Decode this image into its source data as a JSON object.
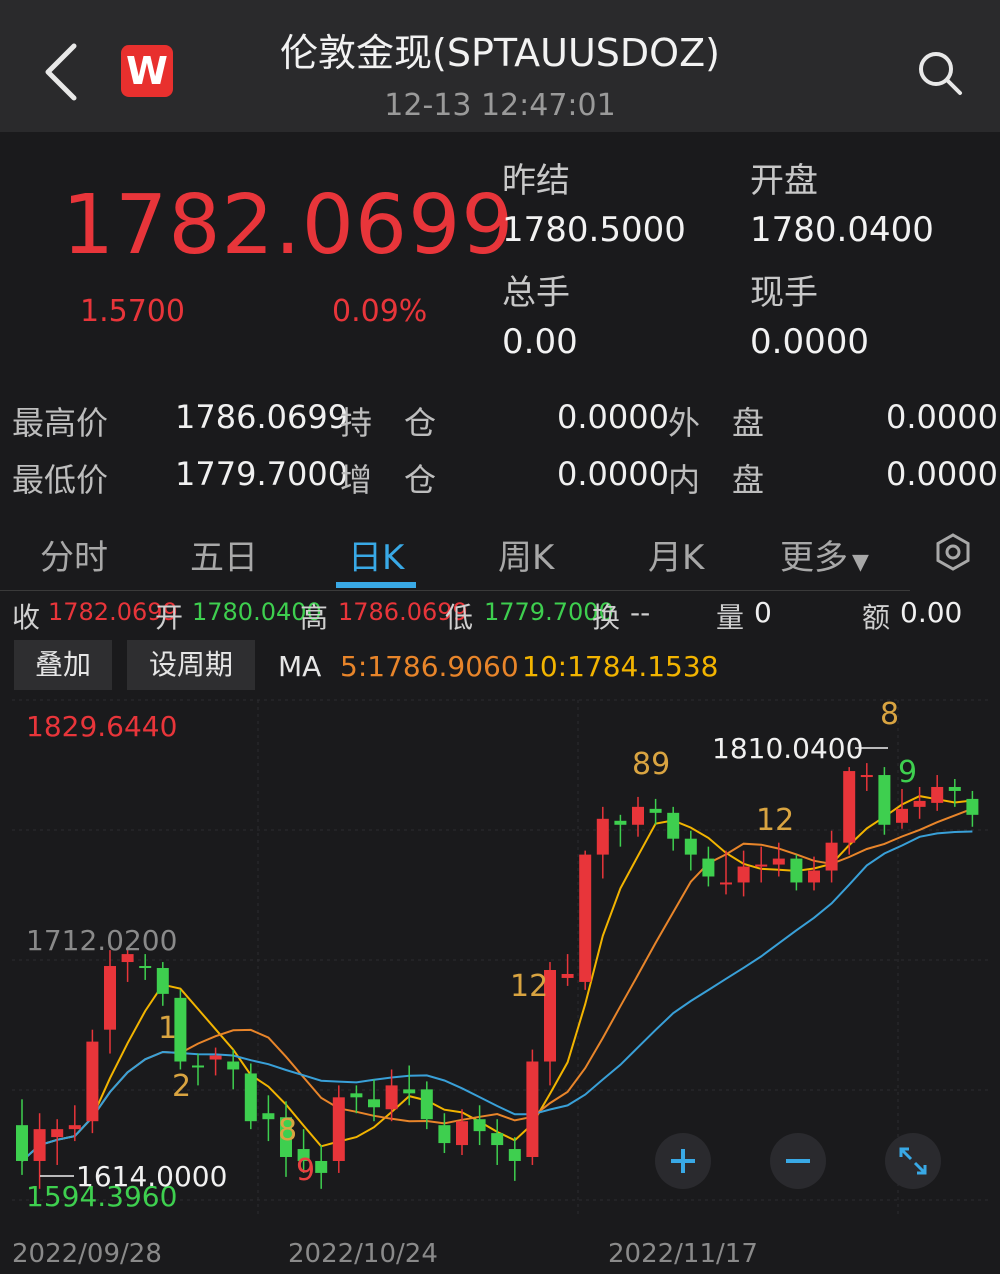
{
  "header": {
    "title": "伦敦金现(SPTAUUSDOZ)",
    "time": "12-13 12:47:01",
    "logo_letter": "W"
  },
  "quote": {
    "price": "1782.0699",
    "change": "1.5700",
    "change_pct": "0.09%",
    "prev_close_label": "昨结",
    "prev_close": "1780.5000",
    "open_label": "开盘",
    "open": "1780.0400",
    "volume_label": "总手",
    "volume": "0.00",
    "current_hand_label": "现手",
    "current_hand": "0.0000"
  },
  "stats": {
    "high_label": "最高价",
    "high": "1786.0699",
    "low_label": "最低价",
    "low": "1779.7000",
    "hold_label": "持　仓",
    "hold": "0.0000",
    "add_label": "增　仓",
    "add": "0.0000",
    "outer_label": "外　盘",
    "outer": "0.0000",
    "inner_label": "内　盘",
    "inner": "0.0000"
  },
  "tabs": [
    "分时",
    "五日",
    "日K",
    "周K",
    "月K",
    "更多"
  ],
  "active_tab": "日K",
  "ohlc_bar": {
    "close_label": "收",
    "close": "1782.0699",
    "open_label": "开",
    "open": "1780.0400",
    "high_label": "高",
    "high": "1786.0699",
    "low_label": "低",
    "low": "1779.7000",
    "turnover_label": "换",
    "turnover": "--",
    "volume_label": "量",
    "volume": "0",
    "amount_label": "额",
    "amount": "0.00"
  },
  "buttons": {
    "overlay": "叠加",
    "period": "设周期"
  },
  "ma": {
    "label": "MA",
    "ma5": "5:1786.9060",
    "ma10": "10:1784.1538"
  },
  "chart_labels": {
    "top": "1829.6440",
    "mid": "1712.0200",
    "bottom": "1594.3960",
    "high_marker": "1810.0400",
    "low_marker": "1614.0000",
    "dates": [
      "2022/09/28",
      "2022/10/24",
      "2022/11/17"
    ],
    "counts": [
      {
        "text": "1",
        "color": "#d9a441"
      },
      {
        "text": "2",
        "color": "#d9a441"
      },
      {
        "text": "8",
        "color": "#d9a441"
      },
      {
        "text": "9",
        "color": "#e84040"
      },
      {
        "text": "12",
        "color": "#d9a441"
      },
      {
        "text": "89",
        "color": "#d9a441"
      },
      {
        "text": "12",
        "color": "#d9a441"
      },
      {
        "text": "8",
        "color": "#d9a441"
      },
      {
        "text": "9",
        "color": "#3ecf4f"
      }
    ]
  },
  "chart_data": {
    "type": "candlestick",
    "y_axis_labels": [
      "1829.6440",
      "1712.0200",
      "1594.3960"
    ],
    "x_tick_labels": [
      "2022/09/28",
      "2022/10/24",
      "2022/11/17"
    ],
    "annotations": [
      "1810.0400",
      "1614.0000"
    ],
    "ma_series": [
      {
        "name": "MA5",
        "color": "#f2b400"
      },
      {
        "name": "MA10",
        "color": "#e8852a"
      },
      {
        "name": "MA20",
        "color": "#39a0d8"
      }
    ],
    "candles": [
      [
        1630,
        1612,
        1643,
        1605
      ],
      [
        1612,
        1628,
        1636,
        1598
      ],
      [
        1624,
        1628,
        1633,
        1610
      ],
      [
        1628,
        1630,
        1640,
        1622
      ],
      [
        1632,
        1672,
        1678,
        1626
      ],
      [
        1678,
        1710,
        1718,
        1666
      ],
      [
        1712,
        1716,
        1719,
        1702
      ],
      [
        1710,
        1709,
        1716,
        1703
      ],
      [
        1709,
        1696,
        1712,
        1690
      ],
      [
        1694,
        1662,
        1698,
        1658
      ],
      [
        1660,
        1659,
        1666,
        1650
      ],
      [
        1663,
        1665,
        1669,
        1655
      ],
      [
        1662,
        1658,
        1668,
        1648
      ],
      [
        1656,
        1632,
        1661,
        1628
      ],
      [
        1636,
        1633,
        1645,
        1622
      ],
      [
        1634,
        1614,
        1642,
        1604
      ],
      [
        1618,
        1612,
        1628,
        1606
      ],
      [
        1612,
        1606,
        1620,
        1598
      ],
      [
        1612,
        1644,
        1650,
        1606
      ],
      [
        1646,
        1644,
        1650,
        1636
      ],
      [
        1643,
        1639,
        1653,
        1632
      ],
      [
        1638,
        1650,
        1658,
        1632
      ],
      [
        1648,
        1646,
        1660,
        1640
      ],
      [
        1648,
        1633,
        1652,
        1628
      ],
      [
        1630,
        1621,
        1636,
        1616
      ],
      [
        1620,
        1632,
        1638,
        1615
      ],
      [
        1633,
        1627,
        1640,
        1620
      ],
      [
        1626,
        1620,
        1633,
        1610
      ],
      [
        1618,
        1612,
        1624,
        1602
      ],
      [
        1614,
        1662,
        1668,
        1610
      ],
      [
        1662,
        1708,
        1712,
        1650
      ],
      [
        1704,
        1706,
        1716,
        1700
      ],
      [
        1702,
        1766,
        1768,
        1698
      ],
      [
        1766,
        1784,
        1790,
        1754
      ],
      [
        1783,
        1781,
        1786,
        1770
      ],
      [
        1781,
        1790,
        1795,
        1775
      ],
      [
        1789,
        1787,
        1794,
        1781
      ],
      [
        1787,
        1774,
        1790,
        1768
      ],
      [
        1774,
        1766,
        1778,
        1758
      ],
      [
        1764,
        1755,
        1770,
        1750
      ],
      [
        1752,
        1752,
        1768,
        1746
      ],
      [
        1752,
        1760,
        1768,
        1745
      ],
      [
        1760,
        1761,
        1770,
        1752
      ],
      [
        1761,
        1764,
        1772,
        1755
      ],
      [
        1764,
        1752,
        1766,
        1748
      ],
      [
        1752,
        1758,
        1765,
        1748
      ],
      [
        1758,
        1772,
        1778,
        1752
      ],
      [
        1772,
        1808,
        1810,
        1766
      ],
      [
        1806,
        1806,
        1812,
        1798
      ],
      [
        1806,
        1781,
        1810,
        1776
      ],
      [
        1782,
        1789,
        1799,
        1779
      ],
      [
        1790,
        1793,
        1800,
        1784
      ],
      [
        1792,
        1800,
        1806,
        1788
      ],
      [
        1800,
        1798,
        1804,
        1790
      ],
      [
        1794,
        1786,
        1798,
        1780
      ]
    ]
  }
}
